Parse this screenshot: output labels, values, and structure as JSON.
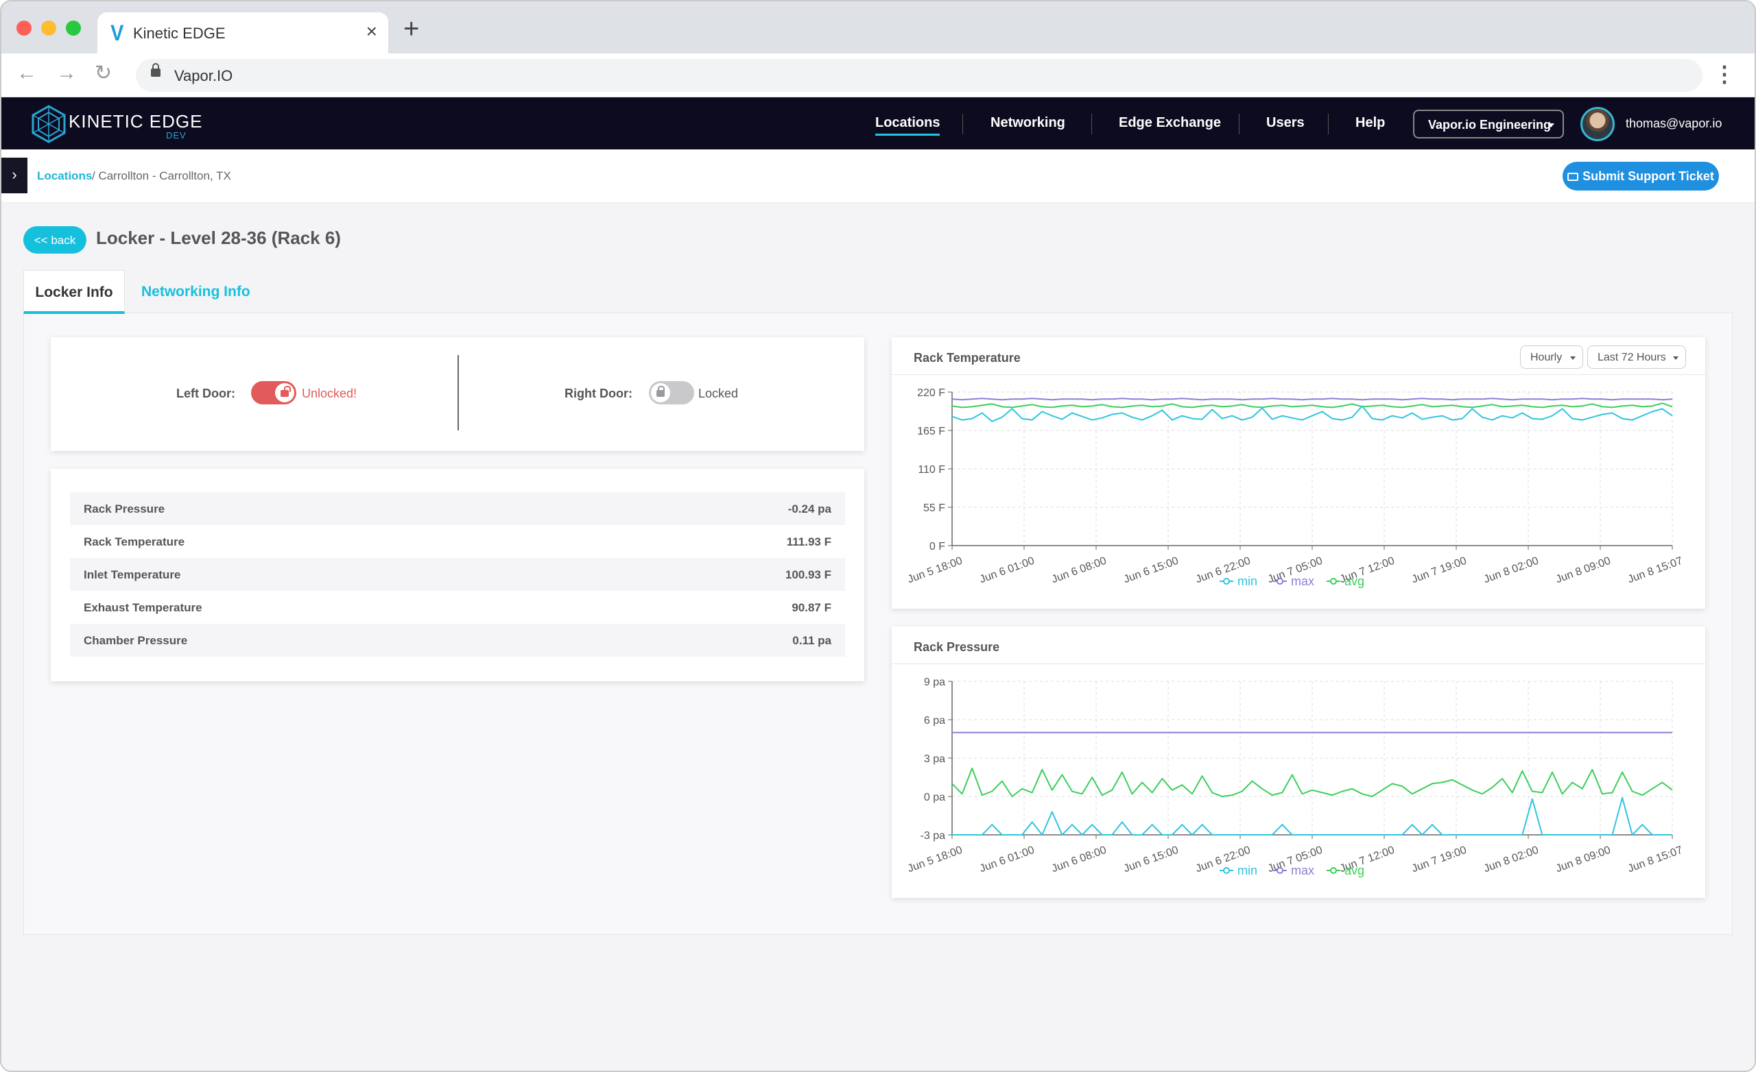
{
  "browser": {
    "tab_title": "Kinetic EDGE",
    "favicon": "V",
    "url": "Vapor.IO",
    "new_tab": "+",
    "close": "×"
  },
  "header": {
    "logo_text": "KINETIC EDGE",
    "logo_sub": "DEV",
    "nav": [
      {
        "label": "Locations",
        "active": true
      },
      {
        "label": "Networking",
        "active": false
      },
      {
        "label": "Edge Exchange",
        "active": false
      },
      {
        "label": "Users",
        "active": false
      },
      {
        "label": "Help",
        "active": false
      }
    ],
    "org_selector": "Vapor.io Engineering",
    "user_email": "thomas@vapor.io"
  },
  "breadcrumb": {
    "link": "Locations",
    "rest": "/ Carrollton - Carrollton, TX"
  },
  "support_button": "Submit Support Ticket",
  "page": {
    "back_label": "<< back",
    "title": "Locker - Level 28-36 (Rack 6)",
    "tabs": [
      {
        "label": "Locker Info",
        "active": true
      },
      {
        "label": "Networking Info",
        "active": false
      }
    ]
  },
  "doors": {
    "left": {
      "label": "Left Door:",
      "status": "Unlocked!",
      "locked": false
    },
    "right": {
      "label": "Right Door:",
      "status": "Locked",
      "locked": true
    }
  },
  "metrics": [
    {
      "name": "Rack Pressure",
      "value": "-0.24 pa"
    },
    {
      "name": "Rack Temperature",
      "value": "111.93 F"
    },
    {
      "name": "Inlet Temperature",
      "value": "100.93 F"
    },
    {
      "name": "Exhaust Temperature",
      "value": "90.87 F"
    },
    {
      "name": "Chamber Pressure",
      "value": "0.11 pa"
    }
  ],
  "colors": {
    "accent": "#15c0dd",
    "min": "#2ec5e0",
    "max": "#8a7fd8",
    "avg": "#3ccf5a",
    "unlocked": "#e35a5a"
  },
  "chart_data": [
    {
      "type": "line",
      "title": "Rack Temperature",
      "controls": {
        "interval": "Hourly",
        "range": "Last 72 Hours"
      },
      "x_ticks": [
        "Jun 5 18:00",
        "Jun 6 01:00",
        "Jun 6 08:00",
        "Jun 6 15:00",
        "Jun 6 22:00",
        "Jun 7 05:00",
        "Jun 7 12:00",
        "Jun 7 19:00",
        "Jun 8 02:00",
        "Jun 8 09:00",
        "Jun 8 15:07"
      ],
      "y_ticks": [
        "220 F",
        "165 F",
        "110 F",
        "55 F",
        "0 F"
      ],
      "ylim": [
        0,
        220
      ],
      "legend": [
        "min",
        "max",
        "avg"
      ],
      "series": [
        {
          "name": "max",
          "values": [
            210,
            209,
            210,
            211,
            210,
            209,
            210,
            210,
            211,
            210,
            209,
            210,
            210,
            210,
            209,
            210,
            210,
            211,
            210,
            210,
            209,
            210,
            210,
            211,
            210,
            209,
            210,
            210,
            210,
            209,
            210,
            210,
            211,
            210,
            210,
            209,
            210,
            210,
            211,
            210,
            210,
            209,
            210,
            210,
            210,
            209,
            210,
            211,
            210,
            210,
            209,
            210,
            210,
            210,
            211,
            210,
            209,
            210,
            210,
            210,
            209,
            210,
            210,
            211,
            210,
            210,
            209,
            210,
            210,
            210,
            210,
            209,
            210
          ]
        },
        {
          "name": "avg",
          "values": [
            200,
            198,
            199,
            201,
            203,
            199,
            198,
            200,
            202,
            199,
            198,
            200,
            201,
            199,
            200,
            202,
            199,
            198,
            200,
            201,
            199,
            200,
            203,
            199,
            198,
            200,
            201,
            199,
            200,
            202,
            199,
            198,
            200,
            201,
            199,
            200,
            201,
            199,
            198,
            200,
            203,
            199,
            200,
            201,
            199,
            198,
            200,
            202,
            199,
            200,
            201,
            199,
            198,
            200,
            202,
            199,
            200,
            201,
            199,
            198,
            200,
            201,
            199,
            200,
            203,
            199,
            198,
            200,
            201,
            199,
            200,
            204,
            199
          ]
        },
        {
          "name": "min",
          "values": [
            185,
            180,
            182,
            190,
            178,
            184,
            196,
            182,
            180,
            192,
            186,
            181,
            190,
            185,
            180,
            183,
            188,
            190,
            184,
            180,
            186,
            194,
            180,
            186,
            182,
            181,
            195,
            182,
            186,
            180,
            184,
            197,
            181,
            186,
            183,
            180,
            186,
            192,
            182,
            180,
            184,
            200,
            182,
            180,
            186,
            183,
            190,
            181,
            184,
            186,
            180,
            182,
            196,
            184,
            180,
            186,
            183,
            190,
            182,
            181,
            186,
            196,
            182,
            180,
            184,
            188,
            190,
            182,
            180,
            186,
            192,
            196,
            186
          ]
        }
      ]
    },
    {
      "type": "line",
      "title": "Rack Pressure",
      "x_ticks": [
        "Jun 5 18:00",
        "Jun 6 01:00",
        "Jun 6 08:00",
        "Jun 6 15:00",
        "Jun 6 22:00",
        "Jun 7 05:00",
        "Jun 7 12:00",
        "Jun 7 19:00",
        "Jun 8 02:00",
        "Jun 8 09:00",
        "Jun 8 15:07"
      ],
      "y_ticks": [
        "9 pa",
        "6 pa",
        "3 pa",
        "0 pa",
        "-3 pa"
      ],
      "ylim": [
        -3,
        9
      ],
      "legend": [
        "min",
        "max",
        "avg"
      ],
      "series": [
        {
          "name": "max",
          "values": [
            5,
            5,
            5,
            5,
            5,
            5,
            5,
            5,
            5,
            5,
            5,
            5,
            5,
            5,
            5,
            5,
            5,
            5,
            5,
            5,
            5,
            5,
            5,
            5,
            5,
            5,
            5,
            5,
            5,
            5,
            5,
            5,
            5,
            5,
            5,
            5,
            5,
            5,
            5,
            5,
            5,
            5,
            5,
            5,
            5,
            5,
            5,
            5,
            5,
            5,
            5,
            5,
            5,
            5,
            5,
            5,
            5,
            5,
            5,
            5,
            5,
            5,
            5,
            5,
            5,
            5,
            5,
            5,
            5,
            5,
            5,
            5,
            5
          ]
        },
        {
          "name": "avg",
          "values": [
            1.0,
            0.2,
            2.2,
            0.1,
            0.4,
            1.2,
            0.0,
            0.6,
            0.3,
            2.1,
            0.5,
            1.7,
            0.4,
            0.2,
            1.5,
            0.1,
            0.5,
            1.9,
            0.2,
            1.1,
            0.3,
            1.4,
            0.5,
            0.9,
            0.2,
            1.6,
            0.3,
            0.0,
            0.1,
            0.4,
            1.2,
            0.6,
            0.1,
            0.3,
            1.7,
            0.2,
            0.5,
            0.3,
            0.1,
            0.4,
            0.6,
            0.2,
            0.0,
            0.5,
            1.0,
            0.8,
            0.2,
            0.6,
            1.0,
            1.1,
            1.3,
            0.9,
            0.5,
            0.2,
            0.7,
            1.4,
            0.3,
            2.0,
            0.4,
            0.3,
            1.9,
            0.2,
            1.1,
            0.6,
            2.1,
            0.2,
            0.3,
            1.9,
            0.4,
            0.1,
            0.6,
            1.1,
            0.5
          ]
        },
        {
          "name": "min",
          "values": [
            -3,
            -3,
            -3,
            -3,
            -2.2,
            -3,
            -3,
            -3,
            -2,
            -3,
            -1.2,
            -3,
            -2.2,
            -3,
            -2.2,
            -3,
            -3,
            -2,
            -3,
            -3,
            -2.2,
            -3,
            -3,
            -2.2,
            -3,
            -2.2,
            -3,
            -3,
            -3,
            -3,
            -3,
            -3,
            -3,
            -2.2,
            -3,
            -3,
            -3,
            -3,
            -3,
            -3,
            -3,
            -3,
            -3,
            -3,
            -3,
            -3,
            -2.2,
            -3,
            -2.2,
            -3,
            -3,
            -3,
            -3,
            -3,
            -3,
            -3,
            -3,
            -3,
            -0.2,
            -3,
            -3,
            -3,
            -3,
            -3,
            -3,
            -3,
            -3,
            -0.1,
            -3,
            -2.2,
            -3,
            -3,
            -3
          ]
        }
      ]
    }
  ]
}
